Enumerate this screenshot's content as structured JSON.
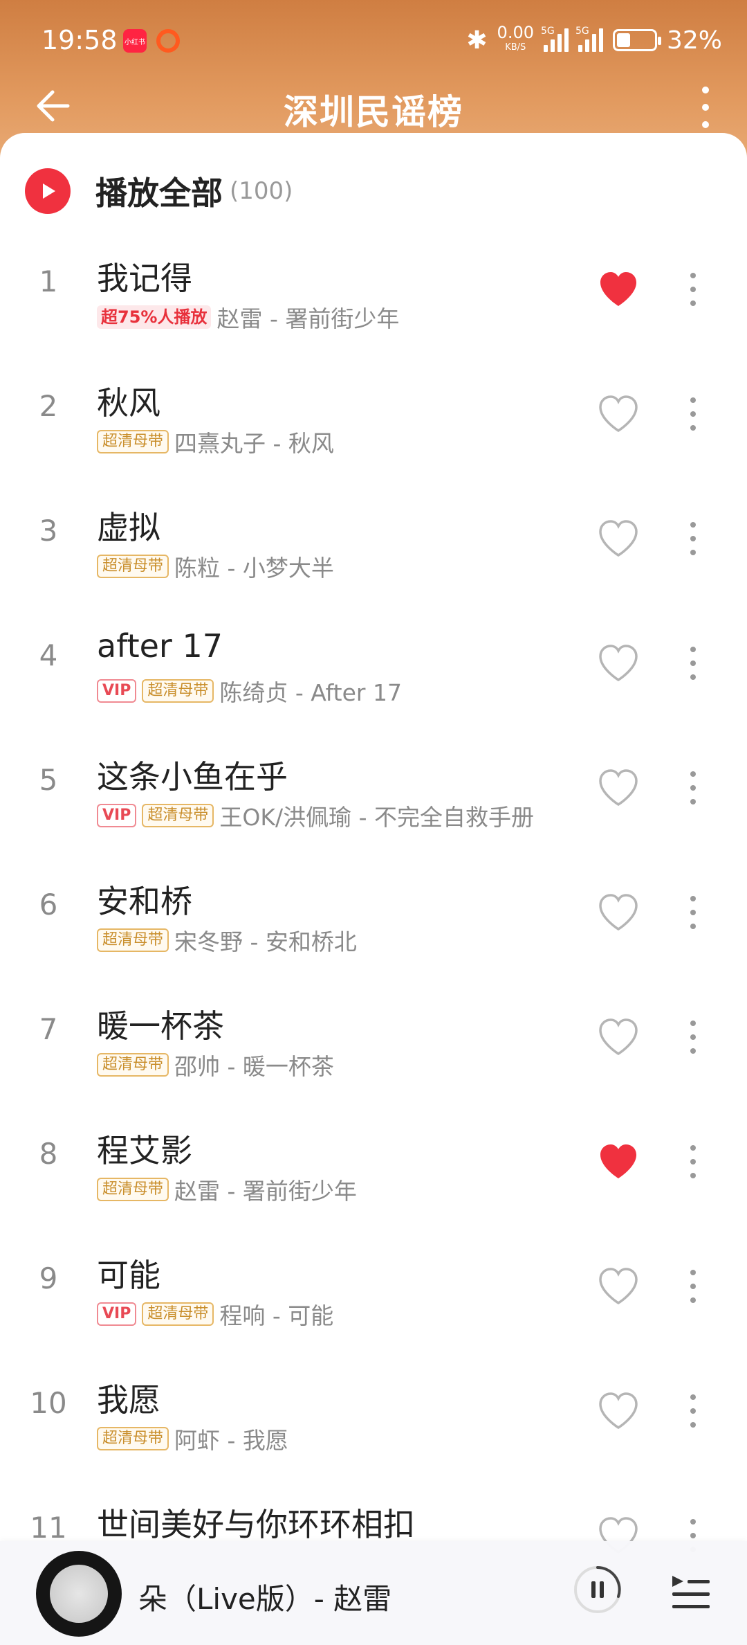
{
  "status_bar": {
    "time": "19:58",
    "app_badge": "小红书",
    "net_speed_value": "0.00",
    "net_speed_unit": "KB/S",
    "signal1_label": "5G",
    "signal2_label": "5G",
    "battery_pct": "32%",
    "battery_level": 0.32
  },
  "header": {
    "title": "深圳民谣榜"
  },
  "play_all": {
    "label": "播放全部",
    "count": "(100)"
  },
  "songs": [
    {
      "index": "1",
      "title": "我记得",
      "tags": [
        {
          "type": "hot",
          "text": "超75%人播放"
        }
      ],
      "meta": "赵雷 - 署前街少年",
      "liked": true
    },
    {
      "index": "2",
      "title": "秋风",
      "tags": [
        {
          "type": "hq",
          "text": "超清母带"
        }
      ],
      "meta": "四熹丸子 - 秋风",
      "liked": false
    },
    {
      "index": "3",
      "title": "虚拟",
      "tags": [
        {
          "type": "hq",
          "text": "超清母带"
        }
      ],
      "meta": "陈粒 - 小梦大半",
      "liked": false
    },
    {
      "index": "4",
      "title": "after 17",
      "tags": [
        {
          "type": "vip",
          "text": "VIP"
        },
        {
          "type": "hq",
          "text": "超清母带"
        }
      ],
      "meta": "陈绮贞 - After 17",
      "liked": false
    },
    {
      "index": "5",
      "title": "这条小鱼在乎",
      "tags": [
        {
          "type": "vip",
          "text": "VIP"
        },
        {
          "type": "hq",
          "text": "超清母带"
        }
      ],
      "meta": "王OK/洪佩瑜 - 不完全自救手册",
      "liked": false
    },
    {
      "index": "6",
      "title": "安和桥",
      "tags": [
        {
          "type": "hq",
          "text": "超清母带"
        }
      ],
      "meta": "宋冬野 - 安和桥北",
      "liked": false
    },
    {
      "index": "7",
      "title": "暖一杯茶",
      "tags": [
        {
          "type": "hq",
          "text": "超清母带"
        }
      ],
      "meta": "邵帅 - 暖一杯茶",
      "liked": false
    },
    {
      "index": "8",
      "title": "程艾影",
      "tags": [
        {
          "type": "hq",
          "text": "超清母带"
        }
      ],
      "meta": "赵雷 - 署前街少年",
      "liked": true
    },
    {
      "index": "9",
      "title": "可能",
      "tags": [
        {
          "type": "vip",
          "text": "VIP"
        },
        {
          "type": "hq",
          "text": "超清母带"
        }
      ],
      "meta": "程响 - 可能",
      "liked": false
    },
    {
      "index": "10",
      "title": "我愿",
      "tags": [
        {
          "type": "hq",
          "text": "超清母带"
        }
      ],
      "meta": "阿虾 - 我愿",
      "liked": false
    },
    {
      "index": "11",
      "title": "世间美好与你环环相扣",
      "tags": [],
      "meta": "",
      "liked": false
    }
  ],
  "mini_player": {
    "now_playing": "朵（Live版）- 赵雷"
  },
  "colors": {
    "accent_red": "#f0313f",
    "liked_heart": "#f0313f",
    "header_gradient_top": "#cf7e42",
    "header_gradient_bottom": "#eeb98a"
  },
  "icons": {
    "back": "back-arrow-icon",
    "more": "more-vert-icon",
    "play": "play-icon",
    "heart": "heart-icon",
    "pause": "pause-icon",
    "playlist": "playlist-icon",
    "bluetooth": "bluetooth-icon"
  }
}
